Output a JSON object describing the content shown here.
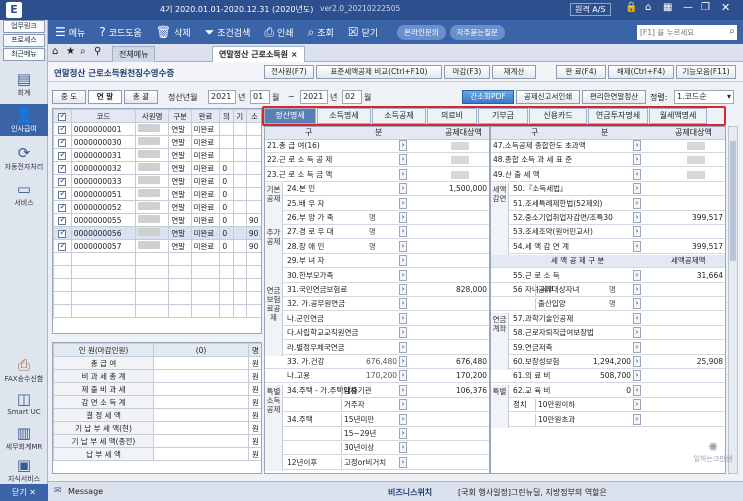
{
  "titlebar": {
    "period": "4기 2020.01.01-2020.12.31 (2020년도)",
    "version": "ver2.0_20210222505",
    "help": "원격 A/S"
  },
  "menubar": [
    "메뉴",
    "코드도움",
    "삭제",
    "조건검색",
    "인쇄",
    "조회",
    "닫기"
  ],
  "menu_pills": [
    "온라인문의",
    "자주묻는질문"
  ],
  "search_placeholder": "[F1] 을 누르세요",
  "sidebar": {
    "btns": [
      "업무링크",
      "프로세스",
      "최근메뉴"
    ],
    "items": [
      "회계",
      "인사급여",
      "자동전자처리",
      "서비스"
    ],
    "bottom": [
      "FAX송수신함",
      "Smart UC",
      "세무회계MR",
      "지식서비스"
    ],
    "close": "닫기"
  },
  "tabs": [
    "전체메뉴",
    "연말정산 근로소득원"
  ],
  "page_title": "연말정산 근로소득원천징수영수증",
  "toolbar": [
    "전사원(F7)",
    "표준세액공제 비교(Ctrl+F10)",
    "마감(F3)",
    "재계산",
    "완 료(F4)",
    "해제(Ctrl+F4)",
    "기능모음(F11)"
  ],
  "filter": {
    "tabs": [
      "중 도",
      "연 말",
      "총 괄"
    ],
    "label": "정산년월",
    "year": "2021",
    "y_unit": "년",
    "month": "01",
    "m_unit": "월",
    "tilde": "~",
    "year2": "2021",
    "month2": "02",
    "sort_label": "정렬:",
    "sort_value": "1.코드순"
  },
  "action_btns": [
    "간소화PDF",
    "공제신고서인쇄",
    "편리한연말정산"
  ],
  "emp_cols": [
    "코드",
    "사원명",
    "구분",
    "완료",
    "의",
    "기",
    "소"
  ],
  "emps": [
    {
      "code": "0000000001",
      "type": "연말",
      "done": "미완료",
      "chk": true,
      "n": ""
    },
    {
      "code": "0000000030",
      "type": "연말",
      "done": "미완료",
      "chk": true,
      "n": ""
    },
    {
      "code": "0000000031",
      "type": "연말",
      "done": "미완료",
      "chk": true,
      "n": ""
    },
    {
      "code": "0000000032",
      "type": "연말",
      "done": "미완료",
      "chk": true,
      "n": "0"
    },
    {
      "code": "0000000033",
      "type": "연말",
      "done": "미완료",
      "chk": true,
      "n": "0"
    },
    {
      "code": "0000000051",
      "type": "연말",
      "done": "미완료",
      "chk": true,
      "n": "0"
    },
    {
      "code": "0000000052",
      "type": "연말",
      "done": "미완료",
      "chk": true,
      "n": "0"
    },
    {
      "code": "0000000055",
      "type": "연말",
      "done": "미완료",
      "chk": true,
      "n": "0",
      "n2": "90"
    },
    {
      "code": "0000000056",
      "type": "연말",
      "done": "미완료",
      "chk": true,
      "n": "0",
      "n2": "90",
      "sel": true
    },
    {
      "code": "0000000057",
      "type": "연말",
      "done": "미완료",
      "chk": true,
      "n": "0",
      "n2": "90"
    }
  ],
  "summary": {
    "head": [
      "인 원(마감인원)",
      "(0)",
      "명"
    ],
    "rows": [
      [
        "총 급 여",
        "",
        "원"
      ],
      [
        "비 과 세 총 계",
        "",
        "원"
      ],
      [
        "제 출 비 과 세",
        "",
        "원"
      ],
      [
        "감 면 소 득 계",
        "",
        "원"
      ],
      [
        "결 정 세 액",
        "",
        "원"
      ],
      [
        "기 납 부 세 액(현)",
        "",
        "원"
      ],
      [
        "기 납 부 세 액(종전)",
        "",
        "원"
      ],
      [
        "납 부 세 액",
        "",
        "원"
      ]
    ]
  },
  "detail_tabs": [
    "정산명세",
    "소득명세",
    "소득공제",
    "의료비",
    "기부금",
    "신용카드",
    "연금투자명세",
    "월세액명세"
  ],
  "left_panel": {
    "h1": "구",
    "h2": "분",
    "h3": "공제대상액",
    "rows": [
      {
        "t": "21.총 급 여(16)"
      },
      {
        "t": "22.근 로 소 득 공 제"
      },
      {
        "t": "23.근 로 소 득 금 액"
      },
      {
        "t": "24.본 인",
        "v": "1,500,000"
      },
      {
        "t": "25.배 우 자"
      },
      {
        "t": "26.부 양 가 족",
        "p": "명"
      },
      {
        "t": "27.경 로 우 대",
        "p": "명"
      },
      {
        "t": "28.장 애 인",
        "p": "명"
      },
      {
        "t": "29.부 녀 자"
      },
      {
        "t": "30.한부모가족"
      },
      {
        "t": "31.국민연금보험료",
        "v": "828,000"
      },
      {
        "t": "32. 가.공무원연금"
      },
      {
        "t": "나.군인연금"
      },
      {
        "t": "다.사립학교교직원연금"
      },
      {
        "t": "라.별정우체국연금"
      },
      {
        "t": "33. 가.건강",
        "a": "676,480",
        "v": "676,480"
      },
      {
        "t": "나.고용",
        "a": "170,200",
        "v": "170,200"
      },
      {
        "t": "34.주택 - 가.주택임차차입금원리금상환액",
        "s": "대출기관",
        "v": "106,376"
      },
      {
        "t": "",
        "s": "거주자"
      },
      {
        "t": "34.주택",
        "s2": "11년이전차입분",
        "s": "15년미만"
      },
      {
        "t": "",
        "s": "15~29년"
      },
      {
        "t": "",
        "s": "30년이상"
      },
      {
        "t": "12년이후",
        "s": "고정or비거치"
      }
    ],
    "groups": [
      "기본공제",
      "추가공제",
      "연금보험료공제",
      "특별소득공제"
    ]
  },
  "right_panel": {
    "h1": "구",
    "h2": "분",
    "h3": "공제대상액",
    "rows": [
      {
        "t": "47.소득공제 종합한도 초과액"
      },
      {
        "t": "48.종합 소득 과 세 표 준"
      },
      {
        "t": "49.산 출 세 액"
      },
      {
        "t": "50.『소득세법』"
      },
      {
        "t": "51.조세특례제한법(52제외)"
      },
      {
        "t": "52.중소기업취업자감면/조특30",
        "v": "399,517"
      },
      {
        "t": "53.조세조약(원어민교사)"
      },
      {
        "t": "54.세 액 감 면 계",
        "v": "399,517"
      },
      {
        "t": "세 액 공 제 구 분",
        "h": "세액공제액"
      },
      {
        "t": "55.근 로 소 득",
        "v": "31,664"
      },
      {
        "t": "56 자녀 세액 공제",
        "s": "공제대상자녀",
        "p": "명"
      },
      {
        "t": "",
        "s": "출산입양",
        "p": "명"
      },
      {
        "t": "57.과학기술인공제"
      },
      {
        "t": "58.근로자퇴직급여보장법"
      },
      {
        "t": "59.연금저축"
      },
      {
        "t": "60.보장성보험",
        "a": "1,294,200",
        "v": "25,908"
      },
      {
        "t": "61.의 료 비",
        "a": "508,700"
      },
      {
        "t": "62.교 육 비",
        "a": "0"
      },
      {
        "t": "정치",
        "s": "10만원이하"
      },
      {
        "t": "",
        "s": "10만원초과"
      }
    ],
    "groups": [
      "세액감면",
      "연금계좌",
      "특별"
    ]
  },
  "footer": {
    "message": "Message",
    "biz": "비즈니스위치",
    "news": "[국회 행사일정]그린뉴딜, 지방정부의 역할은"
  },
  "watermark": "일하는크만쌤"
}
